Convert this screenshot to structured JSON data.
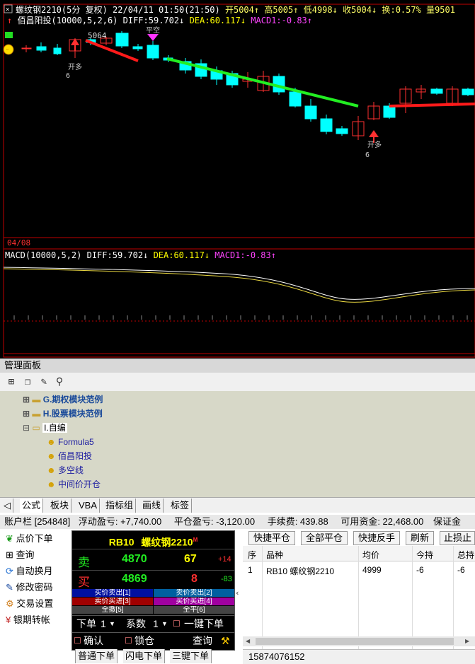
{
  "header": {
    "symbol_line": "螺纹钢2210(5分 复权) 22/04/11 01:50(21:50)",
    "open": "开5004",
    "high": "高5005",
    "low": "低4998",
    "close": "收5004",
    "turnover": "换:0.57%",
    "volume": "量9501",
    "indicator_name": "佰昌阳投(10000,5,2,6)",
    "diff": "DIFF:59.702",
    "dea": "DEA:60.117",
    "macd1": "MACD1:-0.83",
    "price_label": "5064",
    "date_label": "04/08",
    "marker1": "开多",
    "marker2": "平空",
    "marker3": "开多",
    "marker_num": "6"
  },
  "macd": {
    "title": "MACD(10000,5,2)",
    "diff": "DIFF:59.702",
    "dea": "DEA:60.117",
    "macd1": "MACD1:-0.83"
  },
  "panel": {
    "title": "管理面板",
    "tree": [
      {
        "label": "G.期权模块范例"
      },
      {
        "label": "H.股票模块范例"
      },
      {
        "label": "I.自编"
      },
      {
        "label": "Formula5"
      },
      {
        "label": "佰昌阳投"
      },
      {
        "label": "多空线"
      },
      {
        "label": "中间价开仓"
      }
    ],
    "tabs": [
      "公式",
      "板块",
      "VBA",
      "指标组",
      "画线",
      "标签"
    ]
  },
  "account": {
    "bar": "账户栏 [254848]",
    "float_pl": "浮动盈亏: +7,740.00",
    "close_pl": "平仓盈亏: -3,120.00",
    "fee": "手续费: 439.88",
    "available": "可用资金: 22,468.00",
    "margin": "保证金"
  },
  "menu": [
    "点价下单",
    "查询",
    "自动换月",
    "修改密码",
    "交易设置",
    "银期转帐"
  ],
  "order": {
    "code": "RB10",
    "name": "螺纹钢",
    "contract": "2210",
    "badge": "M",
    "sell_label": "卖",
    "sell_price": "4870",
    "sell_qty": "67",
    "sell_chg": "+14",
    "buy_label": "买",
    "buy_price": "4869",
    "buy_qty": "8",
    "buy_chg": "-83",
    "btn1": "买价卖出[1]",
    "btn2": "卖价卖出[2]",
    "btn3": "卖价买进[3]",
    "btn4": "买价买进[4]",
    "btn5": "全撤[5]",
    "btn6": "全平[6]",
    "qty_label": "下单",
    "qty_val": "1",
    "coef_label": "系数",
    "coef_val": "1",
    "oneclick": "一键下单",
    "confirm": "确认",
    "lock": "锁仓",
    "query": "查询"
  },
  "order_tabs": [
    "普通下单",
    "闪电下单",
    "三键下单"
  ],
  "actions": [
    "快捷平仓",
    "全部平仓",
    "快捷反手",
    "刷新",
    "止损止"
  ],
  "positions": {
    "headers": [
      "序",
      "品种",
      "均价",
      "今持",
      "总持"
    ],
    "rows": [
      [
        "1",
        "RB10 螺纹钢2210",
        "4999",
        "-6",
        "-6"
      ]
    ]
  },
  "status": "15874076152",
  "colors": {
    "up": "#ff3030",
    "down": "#00ffff",
    "bg": "#000000"
  }
}
